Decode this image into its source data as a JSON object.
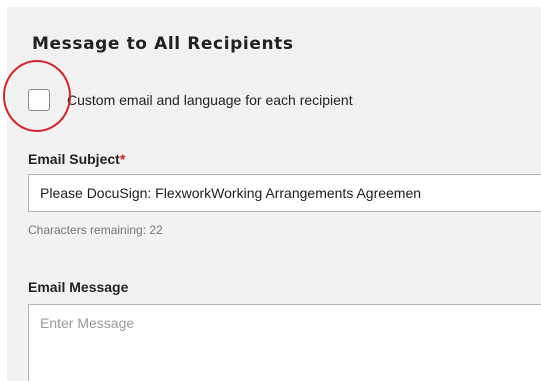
{
  "section": {
    "title": "Message to All Recipients"
  },
  "custom_checkbox": {
    "label": "Custom email and language for each recipient",
    "checked": false
  },
  "email_subject": {
    "label": "Email Subject",
    "required_mark": "*",
    "value": "Please DocuSign: FlexworkWorking Arrangements Agreemen",
    "characters_remaining": "Characters remaining: 22"
  },
  "email_message": {
    "label": "Email Message",
    "placeholder": "Enter Message",
    "value": ""
  },
  "colors": {
    "panel_background": "#f2f2f2",
    "required_mark": "#d01c1c",
    "annotation_circle": "#d8232a"
  }
}
